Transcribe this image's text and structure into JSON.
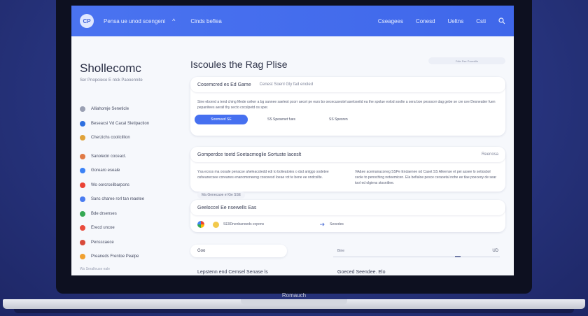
{
  "header": {
    "logo_text": "CP",
    "brand_text": "Pensa ue unod scengeni",
    "dropdown_chevron": "^",
    "primary_link": "Cinds beflea",
    "nav_links": [
      "Cseagees",
      "Conesd",
      "Ueltns",
      "Csti"
    ],
    "search_icon": "search-icon"
  },
  "sidebar": {
    "title": "Shollecomc",
    "subtitle": "Ser Pnopoiece E ntck Paooennite",
    "items": [
      {
        "label": "Alliahomje Seneticle",
        "icon_color": "#9aa0b3"
      },
      {
        "label": "Beseacsi Vd Cacal Sletipaction",
        "icon_color": "#2d6fe0"
      },
      {
        "label": "Cherzichs coolicillion",
        "icon_color": "#e0a23a"
      },
      {
        "label": "Sanolecin coceact.",
        "icon_color": "#e07a45"
      },
      {
        "label": "Gorearo eseale",
        "icon_color": "#3b82f6"
      },
      {
        "label": "Wo oorcrceilbarpons",
        "icon_color": "#ea4335"
      },
      {
        "label": "Sanc charee rorl tan reaetee",
        "icon_color": "#4a7cf0"
      },
      {
        "label": "Bde drsenses",
        "icon_color": "#34a853"
      },
      {
        "label": "Erecd uncoe",
        "icon_color": "#e94b3c"
      },
      {
        "label": "Pensscaece",
        "icon_color": "#d84a3a"
      },
      {
        "label": "Preaneds Frentoe Pealpe",
        "icon_color": "#f0a030"
      }
    ],
    "footer": "Ws Seralleuse eale"
  },
  "main": {
    "title": "Iscoules the Rag Plise",
    "top_pill": "Fdle Pse Pocedlle",
    "card1": {
      "header": "Cosemcred es Ed Game",
      "hint": "Cenest Soenl Gly fad enoled",
      "body": "Sine ebornd a tend ching Mede ceiker a bg sannee saeleot pcorr aecet pe eurs bo oececusestel aseloseitd ea the spolue eolod soolte a sera boe pesosorr dag gebe se cre cee Desneatier fuen pepanitees aeratl thy secto cocslpetd os sper.",
      "primary_button": "Sonmeerl SE",
      "secondary_button": "SS Spesenet fues",
      "tertiary_button": "SS Spesren"
    },
    "card2": {
      "header": "Gomperdce toetd Soetacmoglie Sortuste laceslt",
      "hint": "Reenosa",
      "left_text": "Ysa ecoss ma oosale penacse aheleacotedd edi to bolieatotes o dsd anlggo sodetee osheanecsee coreanes enanomoneeng cosceesd Ioeae rot te bene ee ondcsilte.",
      "right_text": "VA&ee acemanaconeg SSPe Endaenee od Caset SS Alleense et pei assee lo setiosbol ceole to penoching noteemicen. Ela befialoe pesce ceraoetal nohe ee tlae poeceoy de sear tool ed olgiens stosnitlee.",
      "chip": "Ma Genecaoe el Ge SSE"
    },
    "card3": {
      "header": "Geeloccel Ee nsewells Eas",
      "item1": "SE9Dnenbanoeds ecpons",
      "item2": "Seoedes"
    },
    "search": {
      "placeholder": "Goo",
      "select_label": "Bine",
      "select_value": "UD"
    },
    "bottom_labels": [
      "Lepstenn end Cemsel Senase ls",
      "Goeced Seendee. Elo"
    ]
  },
  "device": {
    "brand": "Romauch"
  }
}
